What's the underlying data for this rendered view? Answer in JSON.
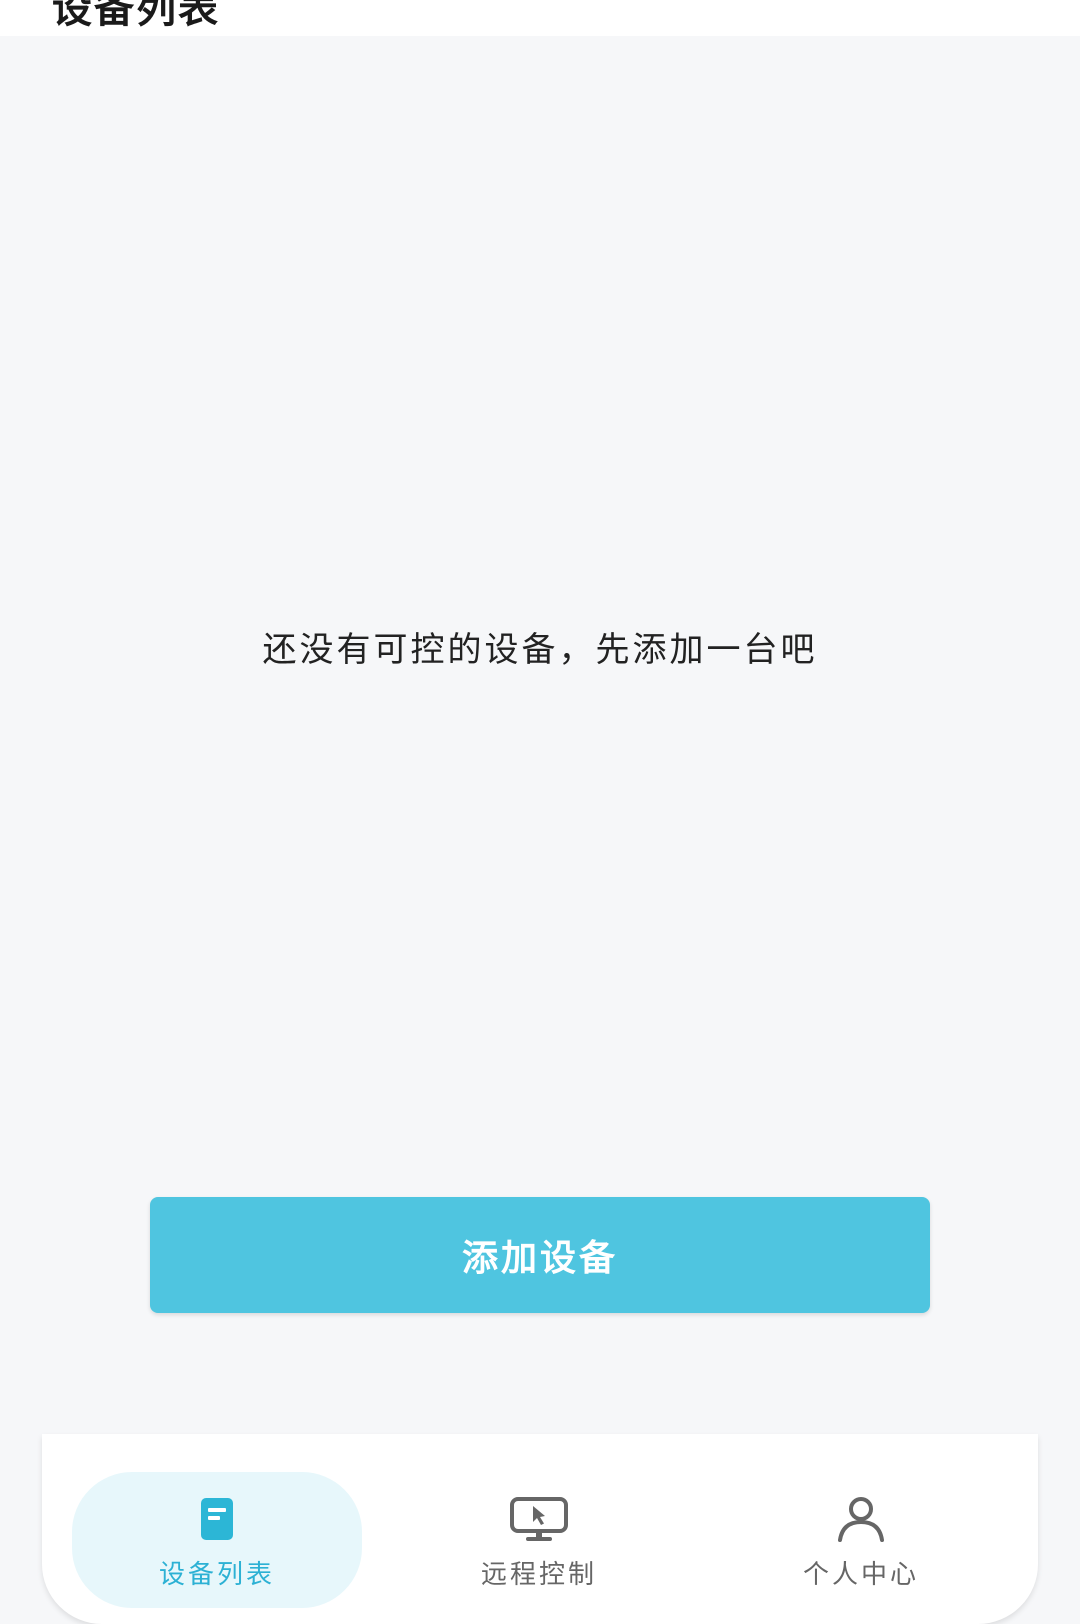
{
  "header": {
    "title": "设备列表"
  },
  "empty_state": {
    "message": "还没有可控的设备，先添加一台吧"
  },
  "actions": {
    "add_device_label": "添加设备"
  },
  "tabbar": {
    "tabs": [
      {
        "label": "设备列表",
        "icon": "device-list-icon",
        "active": true
      },
      {
        "label": "远程控制",
        "icon": "remote-monitor-icon",
        "active": false
      },
      {
        "label": "个人中心",
        "icon": "person-icon",
        "active": false
      }
    ]
  },
  "colors": {
    "accent": "#4fc5e0",
    "active_text": "#2cb1d4",
    "active_tab_bg": "#e7f7fb",
    "background": "#f6f7f9"
  }
}
